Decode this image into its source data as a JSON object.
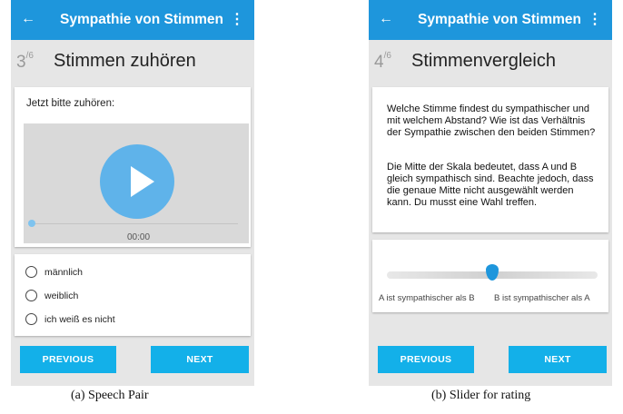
{
  "appbar": {
    "back_icon": "←",
    "title": "Sympathie von Stimmen",
    "menu_icon": "⋮"
  },
  "screen_a": {
    "step": "3",
    "step_total": "/6",
    "heading": "Stimmen zuhören",
    "prompt": "Jetzt bitte zuhören:",
    "player": {
      "time": "00:00",
      "progress": 0
    },
    "options": [
      "männlich",
      "weiblich",
      "ich weiß es nicht"
    ],
    "previous_label": "PREVIOUS",
    "next_label": "NEXT",
    "caption": "(a) Speech Pair"
  },
  "screen_b": {
    "step": "4",
    "step_total": "/6",
    "heading": "Stimmenvergleich",
    "paragraph1": "Welche Stimme findest du sympathischer und mit welchem Abstand? Wie ist das Verhältnis der Sympathie zwischen den beiden Stimmen?",
    "paragraph2": "Die Mitte der Skala bedeutet, dass A und B gleich sympathisch sind. Beachte jedoch, dass die genaue Mitte nicht ausgewählt werden kann. Du musst eine Wahl treffen.",
    "slider": {
      "value": 0.5,
      "left_label": "A ist sympathischer als B",
      "right_label": "B ist sympathischer als A"
    },
    "previous_label": "PREVIOUS",
    "next_label": "NEXT",
    "caption": "(b) Slider for rating"
  },
  "colors": {
    "appbar": "#1e96dc",
    "button": "#13b0e9",
    "play": "#5fb3ea",
    "background": "#e6e6e6"
  }
}
